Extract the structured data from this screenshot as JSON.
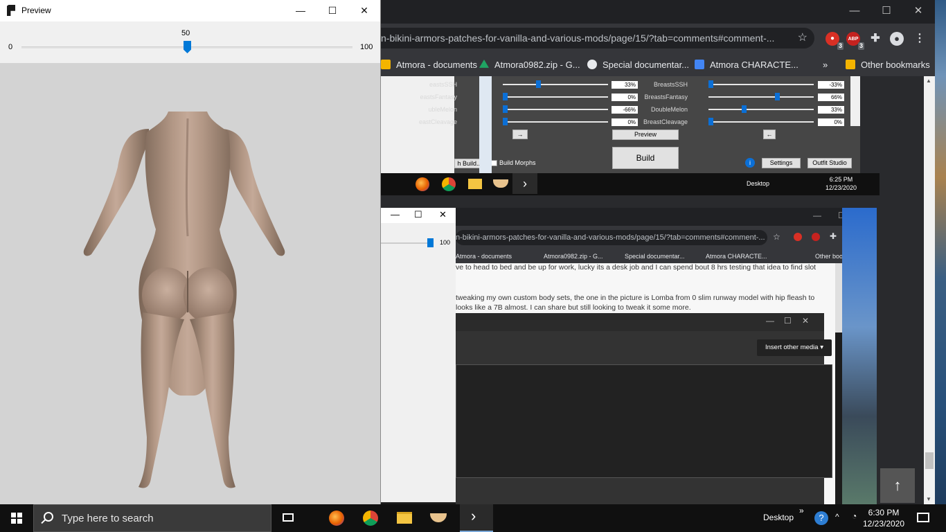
{
  "preview_window": {
    "title": "Preview",
    "slider": {
      "min_label": "0",
      "max_label": "100",
      "value_label": "50",
      "value": 50,
      "min": 0,
      "max": 100
    },
    "controls": {
      "minimize": "—",
      "maximize": "☐",
      "close": "✕"
    }
  },
  "browser": {
    "url": "n-bikini-armors-patches-for-vanilla-and-various-mods/page/15/?tab=comments#comment-...",
    "bookmarks": [
      {
        "label": "Atmora - documents",
        "icon": "bookmark-icon",
        "color": "#f4b400"
      },
      {
        "label": "Atmora0982.zip - G...",
        "icon": "drive-icon",
        "color": "#1fa463"
      },
      {
        "label": "Special documentar...",
        "icon": "globe-icon",
        "color": "#e8eaed"
      },
      {
        "label": "Atmora CHARACTE...",
        "icon": "docs-icon",
        "color": "#4285f4"
      }
    ],
    "more_bookmarks": "»",
    "other_bookmarks": "Other bookmarks",
    "extensions": [
      {
        "icon": "extension-red-icon",
        "badge": "3",
        "color": "#d93025"
      },
      {
        "icon": "adblock-icon",
        "text": "ABP",
        "badge": "3",
        "color": "#c5221f"
      }
    ]
  },
  "bodyslide": {
    "sliders_left": [
      {
        "label": "eastsSSH",
        "value": "33%"
      },
      {
        "label": "eastsFantasy",
        "value": "0%"
      },
      {
        "label": "ubleMelon",
        "value": "-66%"
      },
      {
        "label": "eastCleavage",
        "value": "0%"
      }
    ],
    "sliders_right": [
      {
        "label": "BreastsSSH",
        "value": "-33%"
      },
      {
        "label": "BreastsFantasy",
        "value": "66%"
      },
      {
        "label": "DoubleMelon",
        "value": "33%"
      },
      {
        "label": "BreastCleavage",
        "value": "0%"
      }
    ],
    "arrow_right": "→",
    "arrow_left": "←",
    "preview_button": "Preview",
    "build_button": "Build",
    "batch_build": "h Build...",
    "build_morphs": "Build Morphs",
    "settings_button": "Settings",
    "outfit_studio_button": "Outfit Studio",
    "taskbar_desktop": "Desktop",
    "taskbar_time": "6:25 PM",
    "taskbar_date": "12/23/2020"
  },
  "inner_browser": {
    "url": "n-bikini-armors-patches-for-vanilla-and-various-mods/page/15/?tab=comments#comment-...",
    "bookmarks": [
      "Atmora - documents",
      "Atmora0982.zip - G...",
      "Special documentar...",
      "Atmora CHARACTE..."
    ],
    "other_bookmarks": "Other bookmarks",
    "slider_value": "100",
    "post_lines": [
      "ve to head to bed and be up for work, lucky its a desk job and I can spend bout 8 hrs testing that idea to find slot",
      "tweaking my own custom body sets, the one in the picture is Lomba from 0 slim runway model with hip fleash to",
      "looks like a 7B almost. I can share but still looking to tweak it some more."
    ],
    "insert_media": "Insert other media ▾"
  },
  "taskbar": {
    "search_placeholder": "Type here to search",
    "desktop_label": "Desktop",
    "chevron": "»",
    "time": "6:30 PM",
    "date": "12/23/2020"
  }
}
